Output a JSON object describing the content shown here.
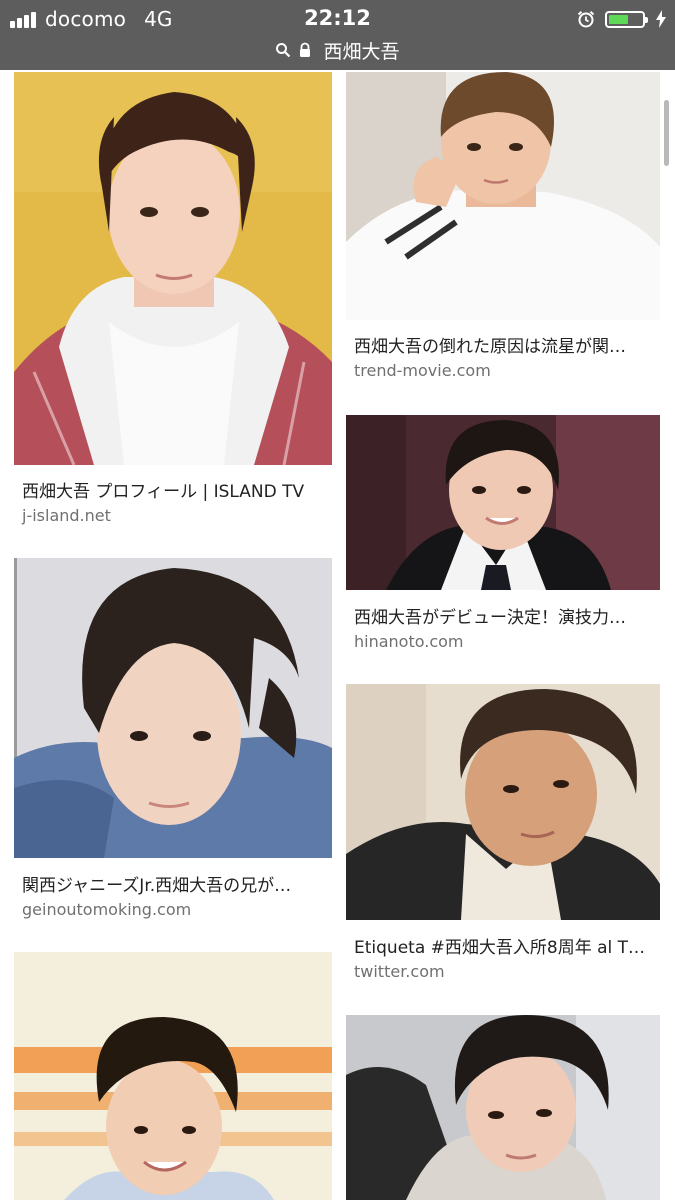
{
  "status_bar": {
    "carrier": "docomo",
    "network": "4G",
    "time": "22:12",
    "battery_level": 0.6,
    "icons": [
      "signal-icon",
      "alarm-icon",
      "battery-icon",
      "charging-icon"
    ]
  },
  "address_bar": {
    "icons": [
      "search-icon",
      "lock-icon"
    ],
    "query": "西畑大吾"
  },
  "colors": {
    "status_bar_bg": "#5d5d5d",
    "battery_fill": "#5fd85a",
    "title_text": "#222222",
    "domain_text": "#707070"
  },
  "results": [
    {
      "title": "西畑大吾 プロフィール | ISLAND TV",
      "domain": "j-island.net"
    },
    {
      "title": "西畑大吾の倒れた原因は流星が関…",
      "domain": "trend-movie.com"
    },
    {
      "title": "西畑大吾がデビュー決定！演技力…",
      "domain": "hinanoto.com"
    },
    {
      "title": "関西ジャニーズJr.西畑大吾の兄が…",
      "domain": "geinoutomoking.com"
    },
    {
      "title": "Etiqueta #西畑大吾入所8周年 al T…",
      "domain": "twitter.com"
    },
    {
      "title": "",
      "domain": ""
    },
    {
      "title": "",
      "domain": ""
    }
  ]
}
